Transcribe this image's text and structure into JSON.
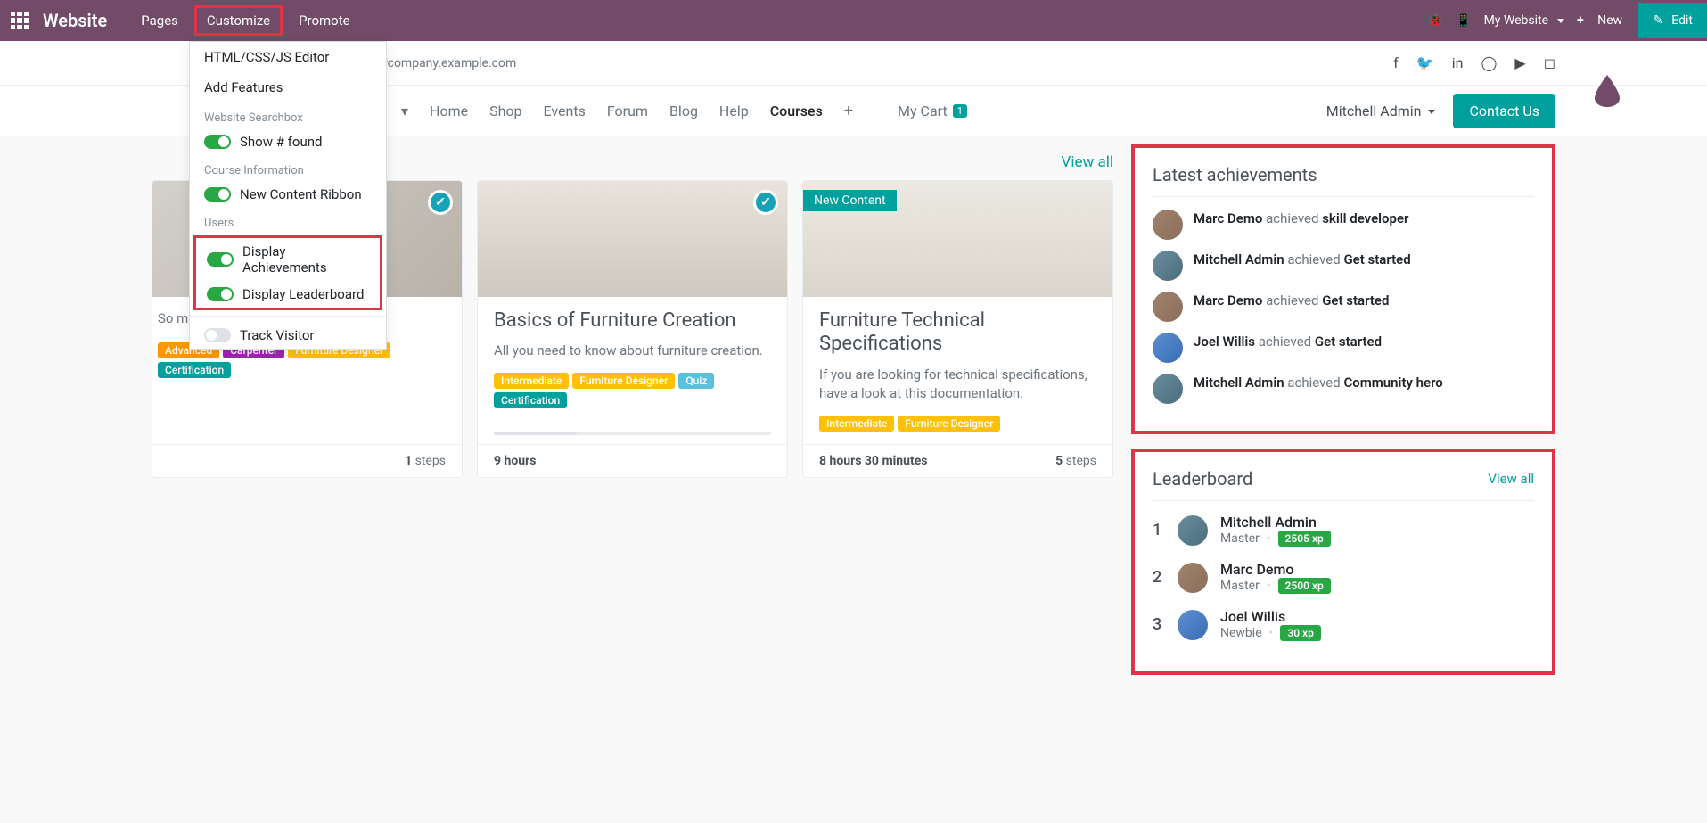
{
  "topbar": {
    "brand": "Website",
    "menu": [
      {
        "label": "Pages"
      },
      {
        "label": "Customize",
        "highlighted": true
      },
      {
        "label": "Promote"
      }
    ],
    "my_website": "My Website",
    "new": "New",
    "edit": "Edit"
  },
  "dropdown": {
    "items": [
      {
        "label": "HTML/CSS/JS Editor"
      },
      {
        "label": "Add Features"
      }
    ],
    "sections": [
      {
        "label": "Website Searchbox",
        "toggles": [
          {
            "label": "Show # found",
            "on": true
          }
        ]
      },
      {
        "label": "Course Information",
        "toggles": [
          {
            "label": "New Content Ribbon",
            "on": true
          }
        ]
      },
      {
        "label": "Users",
        "highlighted_toggles": [
          {
            "label": "Display Achievements",
            "on": true
          },
          {
            "label": "Display Leaderboard",
            "on": true
          }
        ],
        "extra_toggles": [
          {
            "label": "Track Visitor",
            "on": false
          }
        ]
      }
    ]
  },
  "subheader": {
    "email": "rcompany.example.com"
  },
  "nav": {
    "links": [
      "Home",
      "Shop",
      "Events",
      "Forum",
      "Blog",
      "Help",
      "Courses"
    ],
    "active": "Courses",
    "cart_label": "My Cart",
    "cart_count": "1",
    "user": "Mitchell Admin",
    "contact": "Contact Us"
  },
  "courses": {
    "view_all": "View all",
    "cards": [
      {
        "desc": "So much amazing certification.",
        "tags": [
          {
            "text": "Advanced",
            "cls": "orange"
          },
          {
            "text": "Carpenter",
            "cls": "purple"
          },
          {
            "text": "Furniture Designer",
            "cls": "yellow"
          },
          {
            "text": "Certification",
            "cls": "teal"
          }
        ],
        "footer_right_num": "1",
        "footer_right_unit": "steps"
      },
      {
        "title": "Basics of Furniture Creation",
        "desc": "All you need to know about furniture creation.",
        "tags": [
          {
            "text": "Intermediate",
            "cls": "yellow"
          },
          {
            "text": "Furniture Designer",
            "cls": "yellow"
          },
          {
            "text": "Quiz",
            "cls": "blue"
          },
          {
            "text": "Certification",
            "cls": "teal"
          }
        ],
        "footer_left": "9 hours",
        "has_check": true
      },
      {
        "title": "Furniture Technical Specifications",
        "desc": "If you are looking for technical specifications, have a look at this documentation.",
        "tags": [
          {
            "text": "Intermediate",
            "cls": "yellow"
          },
          {
            "text": "Furniture Designer",
            "cls": "yellow"
          }
        ],
        "footer_left": "8 hours 30 minutes",
        "footer_right_num": "5",
        "footer_right_unit": "steps",
        "new_label": "New Content"
      }
    ]
  },
  "achievements": {
    "title": "Latest achievements",
    "items": [
      {
        "user": "Marc Demo",
        "verb": "achieved",
        "badge": "skill developer",
        "avatar": "a1"
      },
      {
        "user": "Mitchell Admin",
        "verb": "achieved",
        "badge": "Get started",
        "avatar": "a2"
      },
      {
        "user": "Marc Demo",
        "verb": "achieved",
        "badge": "Get started",
        "avatar": "a1"
      },
      {
        "user": "Joel Willis",
        "verb": "achieved",
        "badge": "Get started",
        "avatar": "a4"
      },
      {
        "user": "Mitchell Admin",
        "verb": "achieved",
        "badge": "Community hero",
        "avatar": "a2"
      }
    ]
  },
  "leaderboard": {
    "title": "Leaderboard",
    "view_all": "View all",
    "items": [
      {
        "rank": "1",
        "name": "Mitchell Admin",
        "level": "Master",
        "xp": "2505 xp",
        "avatar": "a2"
      },
      {
        "rank": "2",
        "name": "Marc Demo",
        "level": "Master",
        "xp": "2500 xp",
        "avatar": "a1"
      },
      {
        "rank": "3",
        "name": "Joel Willis",
        "level": "Newbie",
        "xp": "30 xp",
        "avatar": "a4"
      }
    ]
  }
}
